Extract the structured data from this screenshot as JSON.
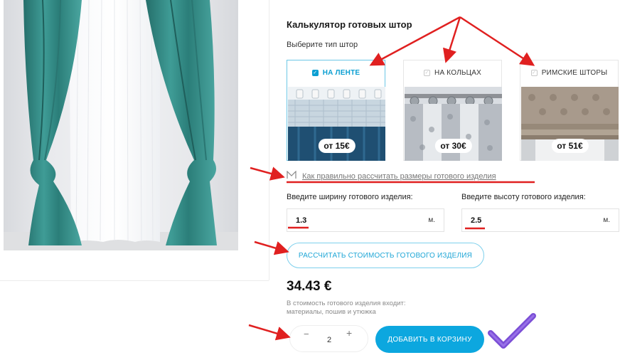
{
  "calculator": {
    "title": "Калькулятор готовых штор",
    "subtitle": "Выберите тип штор"
  },
  "types": [
    {
      "label": "НА ЛЕНТЕ",
      "price": "от 15€",
      "selected": true
    },
    {
      "label": "НА КОЛЬЦАХ",
      "price": "от 30€",
      "selected": false
    },
    {
      "label": "РИМСКИЕ ШТОРЫ",
      "price": "от 51€",
      "selected": false
    }
  ],
  "howto_link": "Как правильно рассчитать размеры готового изделия",
  "width_field": {
    "label": "Введите ширину готового изделия:",
    "value": "1.3",
    "unit": "м."
  },
  "height_field": {
    "label": "Введите высоту готового изделия:",
    "value": "2.5",
    "unit": "м."
  },
  "calc_button": "РАССЧИТАТЬ СТОИМОСТЬ ГОТОВОГО ИЗДЕЛИЯ",
  "total": "34.43 €",
  "note": "В стоимость готового изделия входит: материалы, пошив и утюжка",
  "quantity": {
    "minus": "−",
    "value": "2",
    "plus": "+"
  },
  "add_to_cart": "ДОБАВИТЬ В КОРЗИНУ",
  "colors": {
    "accent": "#0ca7df",
    "annotation_red": "#e02020",
    "checkmark_purple": "#7b4fd6",
    "curtain_teal": "#2f8f8a"
  },
  "icons": {
    "selected_checkbox": "checkbox-checked-icon",
    "ruler": "ruler-icon",
    "check": "checkmark-icon"
  }
}
